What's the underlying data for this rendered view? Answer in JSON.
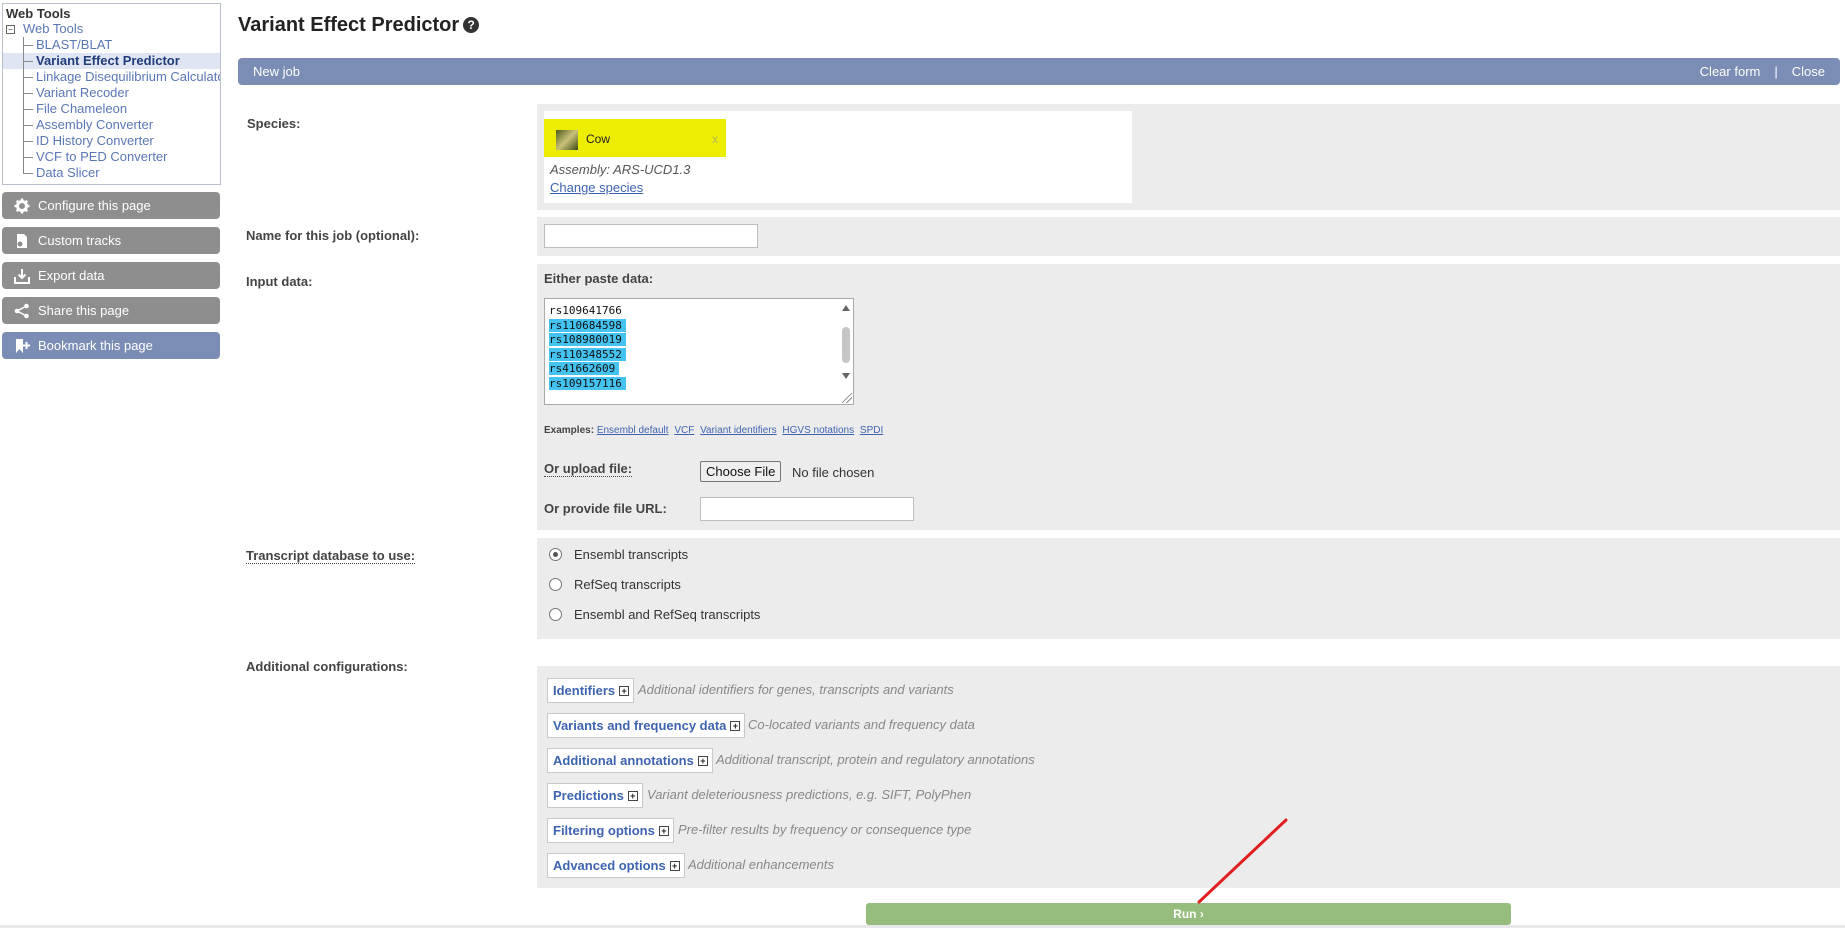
{
  "sidebar": {
    "tree_header": "Web Tools",
    "tree_root": "Web Tools",
    "tree_items": [
      {
        "label": "BLAST/BLAT",
        "active": false
      },
      {
        "label": "Variant Effect Predictor",
        "active": true
      },
      {
        "label": "Linkage Disequilibrium Calculato",
        "active": false
      },
      {
        "label": "Variant Recoder",
        "active": false
      },
      {
        "label": "File Chameleon",
        "active": false
      },
      {
        "label": "Assembly Converter",
        "active": false
      },
      {
        "label": "ID History Converter",
        "active": false
      },
      {
        "label": "VCF to PED Converter",
        "active": false
      },
      {
        "label": "Data Slicer",
        "active": false
      }
    ],
    "buttons": [
      {
        "label": "Configure this page",
        "icon": "gear-icon"
      },
      {
        "label": "Custom tracks",
        "icon": "custom-tracks-icon"
      },
      {
        "label": "Export data",
        "icon": "export-icon"
      },
      {
        "label": "Share this page",
        "icon": "share-icon"
      },
      {
        "label": "Bookmark this page",
        "icon": "bookmark-icon"
      }
    ]
  },
  "page": {
    "title": "Variant Effect Predictor",
    "help_icon": "?"
  },
  "jobbar": {
    "new_job": "New job",
    "clear_form": "Clear form",
    "separator": "|",
    "close": "Close"
  },
  "form": {
    "species_label": "Species:",
    "species_name": "Cow",
    "species_remove": "x",
    "assembly": "Assembly: ARS-UCD1.3",
    "change_species": "Change species",
    "job_name_label": "Name for this job (optional):",
    "job_name_value": "",
    "input_label": "Input data:",
    "paste_label": "Either paste data:",
    "paste_lines": [
      "rs109641766",
      "rs110684598",
      "rs108980019",
      "rs110348552",
      "rs41662609",
      "rs109157116"
    ],
    "examples_label": "Examples:",
    "examples": [
      "Ensembl default",
      "VCF",
      "Variant identifiers",
      "HGVS notations",
      "SPDI"
    ],
    "upload_label": "Or upload file:",
    "choose_file": "Choose File",
    "no_file": "No file chosen",
    "url_label": "Or provide file URL:",
    "url_value": "",
    "transcript_label": "Transcript database to use:",
    "transcript_options": [
      {
        "label": "Ensembl transcripts",
        "checked": true
      },
      {
        "label": "RefSeq transcripts",
        "checked": false
      },
      {
        "label": "Ensembl and RefSeq transcripts",
        "checked": false
      }
    ],
    "additional_label": "Additional configurations:",
    "configs": [
      {
        "title": "Identifiers",
        "desc": "Additional identifiers for genes, transcripts and variants"
      },
      {
        "title": "Variants and frequency data",
        "desc": "Co-located variants and frequency data"
      },
      {
        "title": "Additional annotations",
        "desc": "Additional transcript, protein and regulatory annotations"
      },
      {
        "title": "Predictions",
        "desc": "Variant deleteriousness predictions, e.g. SIFT, PolyPhen"
      },
      {
        "title": "Filtering options",
        "desc": "Pre-filter results by frequency or consequence type"
      },
      {
        "title": "Advanced options",
        "desc": "Additional enhancements"
      }
    ],
    "expand_symbol": "+",
    "run_label": "Run ›"
  },
  "colors": {
    "jobbar": "#7b8cb5",
    "side_button": "#8e8e8e",
    "species_highlight": "#eded00",
    "selection": "#44c3f1",
    "run_button": "#96bd7e",
    "annotation_arrow": "#e02020"
  }
}
